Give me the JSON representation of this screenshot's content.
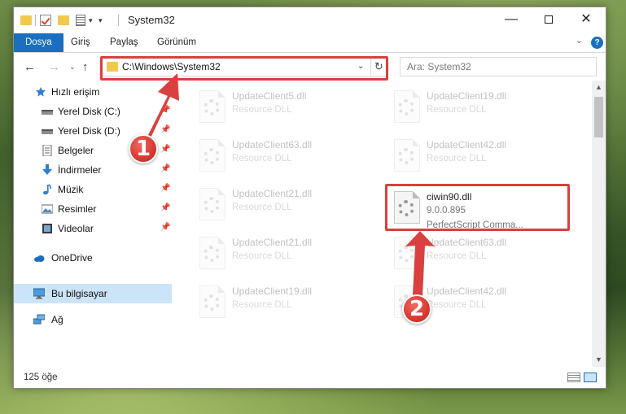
{
  "window": {
    "title": "System32",
    "controls": {
      "minimize": "—",
      "maximize": "",
      "close": "✕"
    }
  },
  "ribbon": {
    "tabs": [
      {
        "label": "Dosya"
      },
      {
        "label": "Giriş"
      },
      {
        "label": "Paylaş"
      },
      {
        "label": "Görünüm"
      }
    ],
    "help": "?"
  },
  "navigation": {
    "address": "C:\\Windows\\System32",
    "search_placeholder": "Ara: System32"
  },
  "sidebar": {
    "items": [
      {
        "label": "Hızlı erişim",
        "icon": "star-icon",
        "pinned": false
      },
      {
        "label": "Yerel Disk (C:)",
        "icon": "drive-icon",
        "pinned": true
      },
      {
        "label": "Yerel Disk (D:)",
        "icon": "drive-icon",
        "pinned": true
      },
      {
        "label": "Belgeler",
        "icon": "document-icon",
        "pinned": true
      },
      {
        "label": "İndirmeler",
        "icon": "download-icon",
        "pinned": true
      },
      {
        "label": "Müzik",
        "icon": "music-icon",
        "pinned": true
      },
      {
        "label": "Resimler",
        "icon": "pictures-icon",
        "pinned": true
      },
      {
        "label": "Videolar",
        "icon": "video-icon",
        "pinned": true
      },
      {
        "label": "OneDrive",
        "icon": "cloud-icon",
        "pinned": false
      },
      {
        "label": "Bu bilgisayar",
        "icon": "computer-icon",
        "pinned": false,
        "selected": true
      },
      {
        "label": "Ağ",
        "icon": "network-icon",
        "pinned": false
      }
    ]
  },
  "files": {
    "left": [
      {
        "name": "UpdateClient5.dll",
        "desc": "Resource DLL"
      },
      {
        "name": "UpdateClient63.dll",
        "desc": "Resource DLL"
      },
      {
        "name": "UpdateClient21.dll",
        "desc": "Resource DLL"
      },
      {
        "name": "UpdateClient21.dll",
        "desc": "Resource DLL"
      },
      {
        "name": "UpdateClient19.dll",
        "desc": "Resource DLL"
      }
    ],
    "right": [
      {
        "name": "UpdateClient19.dll",
        "desc": "Resource DLL"
      },
      {
        "name": "UpdateClient42.dll",
        "desc": "Resource DLL"
      },
      {
        "name": "ciwin90.dll",
        "desc": "9.0.0.895",
        "desc2": "PerfectScript Comma..."
      },
      {
        "name": "UpdateClient63.dll",
        "desc": "Resource DLL"
      },
      {
        "name": "UpdateClient42.dll",
        "desc": "Resource DLL"
      }
    ]
  },
  "status": {
    "count": "125 öğe"
  },
  "annotations": {
    "step1": "1",
    "step2": "2"
  },
  "colors": {
    "accent": "#1a6fc0",
    "annotation": "#d9403f",
    "selected": "#cce4f7"
  }
}
